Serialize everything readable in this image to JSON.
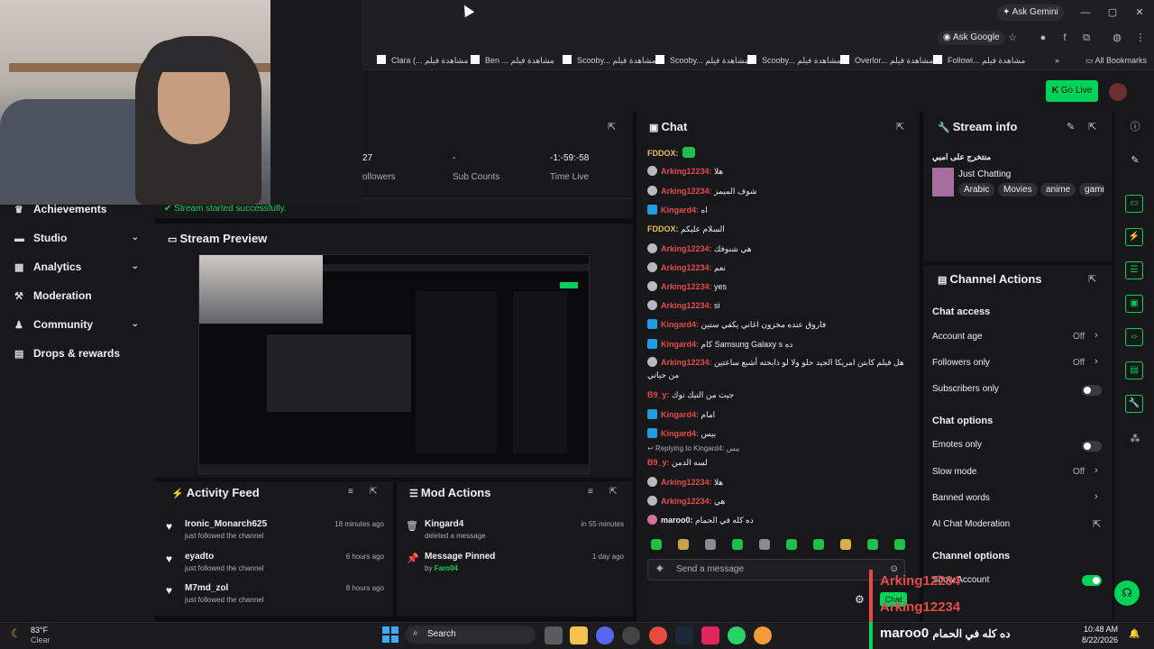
{
  "browser": {
    "ask_gemini": "Ask Gemini",
    "ask_google": "Ask Google",
    "all_bookmarks": "All Bookmarks",
    "bookmarks": [
      "Clara (... مشاهدة فيلم",
      "Ben ... مشاهدة فيلم",
      "Scooby... مشاهدة فيلم",
      "Scooby... مشاهدة فيلم",
      "Scooby... مشاهدة فيلم",
      "Overlor... مشاهدة فيلم",
      "Followi... مشاهدة فيلم"
    ]
  },
  "header": {
    "go_live": "Go Live"
  },
  "nav": {
    "items": [
      {
        "label": "Achievements"
      },
      {
        "label": "Studio"
      },
      {
        "label": "Analytics"
      },
      {
        "label": "Moderation"
      },
      {
        "label": "Community"
      },
      {
        "label": "Drops & rewards"
      }
    ]
  },
  "stats": {
    "followers_value": "27",
    "followers_label": "ollowers",
    "subs_value": "-",
    "subs_label": "Sub Counts",
    "time_value": "-1:-59:-58",
    "time_label": "Time Live"
  },
  "status": {
    "message": "Stream started successfully."
  },
  "preview": {
    "title": "Stream Preview"
  },
  "chat": {
    "title": "Chat",
    "messages": [
      {
        "user": "FDDOX:",
        "text": "",
        "color": "#e8c05a"
      },
      {
        "user": "Arking12234:",
        "text": "هلا",
        "color": "#e34b4b"
      },
      {
        "user": "Arking12234:",
        "text": "شوف الميمز",
        "color": "#e34b4b"
      },
      {
        "user": "Kingard4:",
        "text": "اه",
        "color": "#e34b4b"
      },
      {
        "user": "FDDOX:",
        "text": "السلام عليكم",
        "color": "#e8c05a"
      },
      {
        "user": "Arking12234:",
        "text": "هي شنوفك",
        "color": "#e34b4b"
      },
      {
        "user": "Arking12234:",
        "text": "نعم",
        "color": "#e34b4b"
      },
      {
        "user": "Arking12234:",
        "text": "yes",
        "color": "#e34b4b"
      },
      {
        "user": "Arking12234:",
        "text": "si",
        "color": "#e34b4b"
      },
      {
        "user": "Kingard4:",
        "text": "فاروق عنده مخزون اغاني يكفي ستين",
        "color": "#e34b4b"
      },
      {
        "user": "Kingard4:",
        "text": "كام Samsung Galaxy s ده",
        "color": "#e34b4b"
      },
      {
        "user": "Arking12234:",
        "text": "هل فيلم كابتن امريكا الجيد حلو ولا لو ذابحته أشبع ساعتين من حياتي",
        "color": "#e34b4b"
      },
      {
        "user": "B9_y:",
        "text": "جيت من التيك توك",
        "color": "#e34b4b"
      },
      {
        "user": "Kingard4:",
        "text": "امام",
        "color": "#e34b4b"
      },
      {
        "user": "Kingard4:",
        "text": "بيس",
        "color": "#e34b4b"
      },
      {
        "user": "B9_y:",
        "text": "لسه الدمن",
        "color": "#e34b4b"
      },
      {
        "user": "Arking12234:",
        "text": "هلا",
        "color": "#e34b4b"
      },
      {
        "user": "Arking12234:",
        "text": "هي",
        "color": "#e34b4b"
      },
      {
        "user": "maroo0:",
        "text": "ده كله في الحمام",
        "color": "#efeff1"
      }
    ],
    "reply_to": "Replying to Kingard4: بيس",
    "input_placeholder": "Send a message",
    "send_label": "Chat"
  },
  "stream_info": {
    "title": "Stream info",
    "stream_title": "منتخرج على امبي",
    "category": "Just Chatting",
    "tags": [
      "Arabic",
      "Movies",
      "anime",
      "gami"
    ]
  },
  "channel_actions": {
    "title": "Channel Actions",
    "chat_access": "Chat access",
    "account_age": "Account age",
    "account_age_val": "Off",
    "followers_only": "Followers only",
    "followers_only_val": "Off",
    "subscribers_only": "Subscribers only",
    "chat_options": "Chat options",
    "emotes_only": "Emotes only",
    "slow_mode": "Slow mode",
    "slow_mode_val": "Off",
    "banned_words": "Banned words",
    "ai_moderation": "AI Chat Moderation",
    "channel_options": "Channel options",
    "show_account": "Show Account"
  },
  "activity_feed": {
    "title": "Activity Feed",
    "items": [
      {
        "name": "Ironic_Monarch625",
        "sub": "just followed the channel",
        "time": "18 minutes ago"
      },
      {
        "name": "eyadto",
        "sub": "just followed the channel",
        "time": "6 hours ago"
      },
      {
        "name": "M7md_zol",
        "sub": "just followed the channel",
        "time": "8 hours ago"
      }
    ]
  },
  "mod_actions": {
    "title": "Mod Actions",
    "items": [
      {
        "name": "Kingard4",
        "sub": "deleted a message",
        "time": "in 55 minutes"
      },
      {
        "name": "Message Pinned",
        "sub": "by",
        "by": "Faro04",
        "time": "1 day ago"
      }
    ]
  },
  "overlay": {
    "arking1": "Arking12234",
    "arking2": "Arking12234",
    "bottom_user": "maroo0",
    "bottom_text": "ده كله في الحمام"
  },
  "taskbar": {
    "weather_temp": "83°F",
    "weather_desc": "Clear",
    "search": "Search",
    "time": "10:48 AM",
    "date": "8/22/2026"
  },
  "colors": {
    "accent": "#00d35a",
    "chat_red": "#e34b4b",
    "panel": "#18181b"
  }
}
